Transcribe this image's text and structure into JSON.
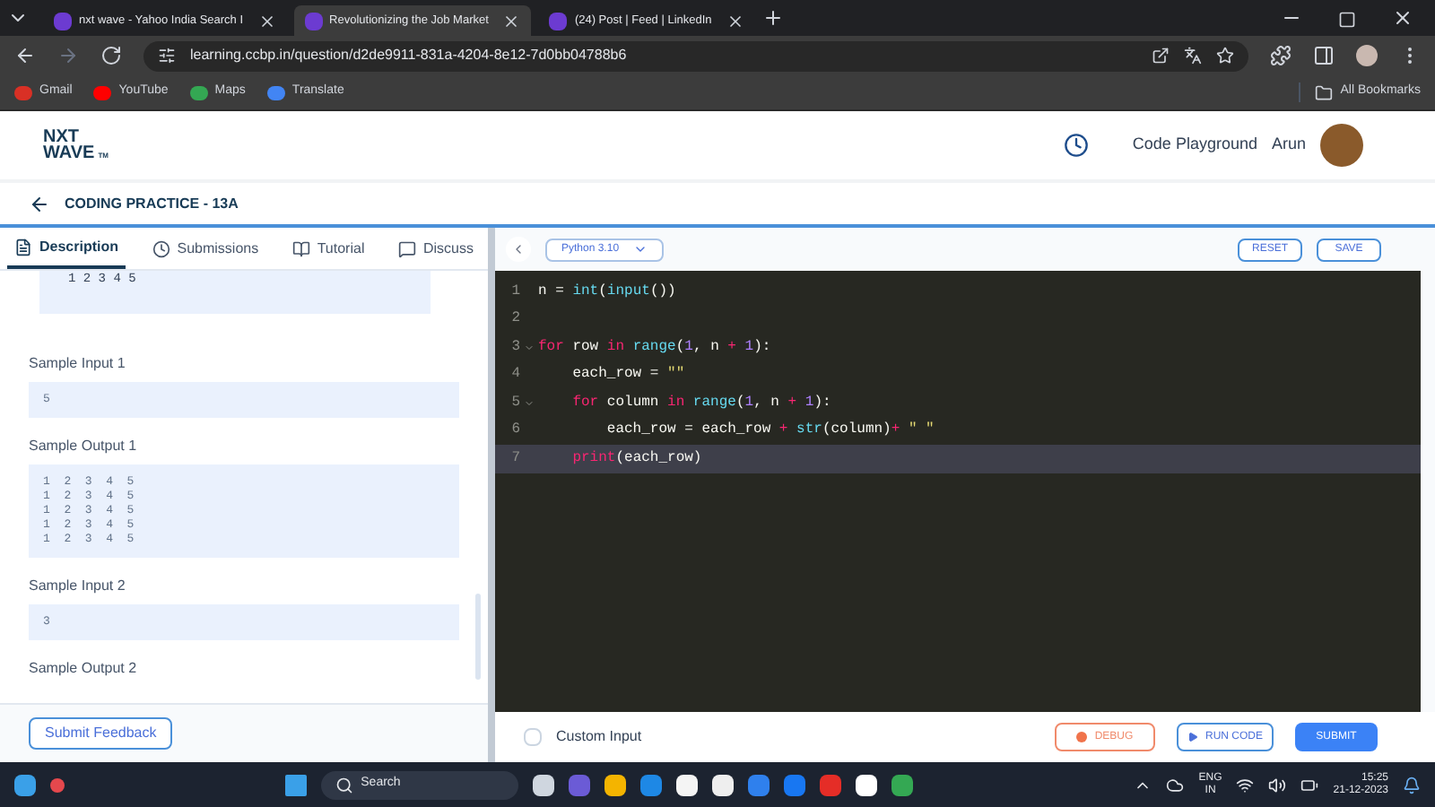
{
  "browser": {
    "tabs": [
      {
        "title": "nxt wave - Yahoo India Search I",
        "selected": false
      },
      {
        "title": "Revolutionizing the Job Market",
        "selected": true
      },
      {
        "title": "(24) Post | Feed | LinkedIn",
        "selected": false
      }
    ],
    "url": "learning.ccbp.in/question/d2de9911-831a-4204-8e12-7d0bb04788b6",
    "bookmarks": [
      "Gmail",
      "YouTube",
      "Maps",
      "Translate"
    ],
    "all_bookmarks": "All Bookmarks"
  },
  "header": {
    "logo_top": "NXT",
    "logo_bottom": "WAVE",
    "logo_mark": "TM",
    "playground": "Code Playground",
    "user": "Arun"
  },
  "page_title": "CODING PRACTICE - 13A",
  "left_tabs": [
    {
      "label": "Description",
      "selected": true
    },
    {
      "label": "Submissions",
      "selected": false
    },
    {
      "label": "Tutorial",
      "selected": false
    },
    {
      "label": "Discuss",
      "selected": false
    }
  ],
  "description": {
    "partial_output": "1 2 3 4 5",
    "samples": [
      {
        "label": "Sample Input 1",
        "lines": [
          "5"
        ]
      },
      {
        "label": "Sample Output 1",
        "lines": [
          "1 2 3 4 5",
          "1 2 3 4 5",
          "1 2 3 4 5",
          "1 2 3 4 5",
          "1 2 3 4 5"
        ]
      },
      {
        "label": "Sample Input 2",
        "lines": [
          "3"
        ]
      },
      {
        "label": "Sample Output 2"
      }
    ]
  },
  "submit_feedback": "Submit Feedback",
  "editor": {
    "language": "Python 3.10",
    "reset": "RESET",
    "save": "SAVE",
    "lines": [
      {
        "number": "1",
        "active": false,
        "foldable": false,
        "tokens": [
          {
            "kind": "plain",
            "text": "n = "
          },
          {
            "kind": "func",
            "text": "int"
          },
          {
            "kind": "plain",
            "text": "("
          },
          {
            "kind": "func",
            "text": "input"
          },
          {
            "kind": "plain",
            "text": "())"
          }
        ]
      },
      {
        "number": "2",
        "active": false,
        "foldable": false
      },
      {
        "number": "3",
        "active": false,
        "foldable": true,
        "tokens": [
          {
            "kind": "keyword",
            "text": "for"
          },
          {
            "kind": "plain",
            "text": " row "
          },
          {
            "kind": "keyword",
            "text": "in"
          },
          {
            "kind": "func",
            "text": " range"
          },
          {
            "kind": "plain",
            "text": "("
          },
          {
            "kind": "number",
            "text": "1"
          },
          {
            "kind": "plain",
            "text": ", n "
          },
          {
            "kind": "keyword",
            "text": "+"
          },
          {
            "kind": "number",
            "text": " 1"
          },
          {
            "kind": "plain",
            "text": "):"
          }
        ]
      },
      {
        "number": "4",
        "active": false,
        "foldable": false,
        "tokens": [
          {
            "kind": "plain",
            "text": "    each_row = "
          },
          {
            "kind": "string",
            "text": "\"\""
          }
        ]
      },
      {
        "number": "5",
        "active": false,
        "foldable": true,
        "tokens": [
          {
            "kind": "keyword",
            "text": "    for"
          },
          {
            "kind": "plain",
            "text": " column "
          },
          {
            "kind": "keyword",
            "text": "in"
          },
          {
            "kind": "func",
            "text": " range"
          },
          {
            "kind": "plain",
            "text": "("
          },
          {
            "kind": "number",
            "text": "1"
          },
          {
            "kind": "plain",
            "text": ", n "
          },
          {
            "kind": "keyword",
            "text": "+"
          },
          {
            "kind": "number",
            "text": " 1"
          },
          {
            "kind": "plain",
            "text": "):"
          }
        ]
      },
      {
        "number": "6",
        "active": false,
        "foldable": false,
        "tokens": [
          {
            "kind": "plain",
            "text": "        each_row = each_row "
          },
          {
            "kind": "keyword",
            "text": "+"
          },
          {
            "kind": "func",
            "text": " str"
          },
          {
            "kind": "plain",
            "text": "(column)"
          },
          {
            "kind": "keyword",
            "text": "+"
          },
          {
            "kind": "string",
            "text": " \" \""
          }
        ]
      },
      {
        "number": "7",
        "active": true,
        "foldable": false,
        "tokens": [
          {
            "kind": "keyword",
            "text": "    print"
          },
          {
            "kind": "plain",
            "text": "(each_row)"
          }
        ]
      }
    ]
  },
  "footer": {
    "custom_input": {
      "label": "Custom Input",
      "checked": false
    },
    "debug": "DEBUG",
    "run_code": "RUN CODE",
    "submit": "SUBMIT"
  },
  "taskbar": {
    "search": "Search",
    "lang_top": "ENG",
    "lang_bottom": "IN",
    "time": "15:25",
    "date": "21-12-2023"
  }
}
